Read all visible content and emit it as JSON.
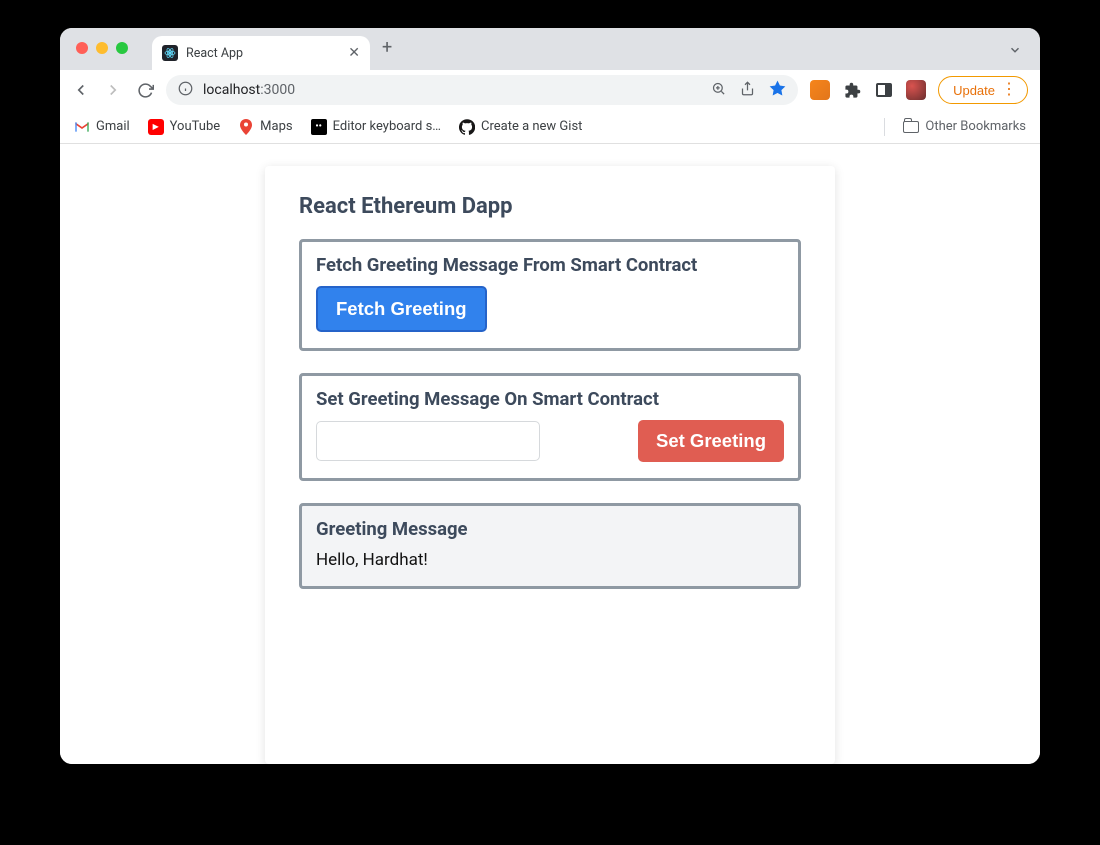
{
  "browser": {
    "tab_title": "React App",
    "url_host": "localhost",
    "url_port": ":3000",
    "update_label": "Update"
  },
  "bookmarks": {
    "items": [
      "Gmail",
      "YouTube",
      "Maps",
      "Editor keyboard s…",
      "Create a new Gist"
    ],
    "other": "Other Bookmarks"
  },
  "app": {
    "title": "React Ethereum Dapp",
    "fetch": {
      "heading": "Fetch Greeting Message From Smart Contract",
      "button": "Fetch Greeting"
    },
    "set": {
      "heading": "Set Greeting Message On Smart Contract",
      "button": "Set Greeting",
      "input_value": ""
    },
    "display": {
      "heading": "Greeting Message",
      "value": "Hello, Hardhat!"
    }
  }
}
